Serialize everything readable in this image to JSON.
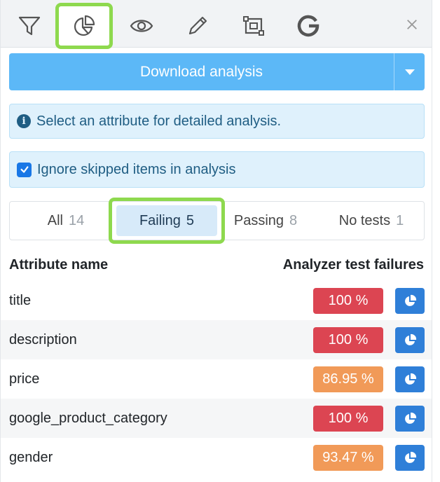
{
  "toolbar": {
    "tools": [
      "filter-icon",
      "chart-pie-icon",
      "eye-icon",
      "pencil-icon",
      "frame-icon",
      "google-icon"
    ],
    "active_tool": "chart-pie-icon",
    "close": "×"
  },
  "download": {
    "label": "Download analysis"
  },
  "info": {
    "text": "Select an attribute for detailed analysis."
  },
  "ignore": {
    "label": "Ignore skipped items in analysis",
    "checked": true
  },
  "tabs": [
    {
      "label": "All",
      "count": "14"
    },
    {
      "label": "Failing",
      "count": "5"
    },
    {
      "label": "Passing",
      "count": "8"
    },
    {
      "label": "No tests",
      "count": "1"
    }
  ],
  "table": {
    "headers": [
      "Attribute name",
      "Analyzer test failures"
    ],
    "rows": [
      {
        "name": "title",
        "pct": "100 %",
        "color": "#dc4552"
      },
      {
        "name": "description",
        "pct": "100 %",
        "color": "#dc4552"
      },
      {
        "name": "price",
        "pct": "86.95 %",
        "color": "#f19a58"
      },
      {
        "name": "google_product_category",
        "pct": "100 %",
        "color": "#dc4552"
      },
      {
        "name": "gender",
        "pct": "93.47 %",
        "color": "#f19a58"
      }
    ]
  },
  "colors": {
    "accent": "#5cb8f7",
    "highlight": "#8ed94e",
    "info_bg": "#dff1fc"
  }
}
